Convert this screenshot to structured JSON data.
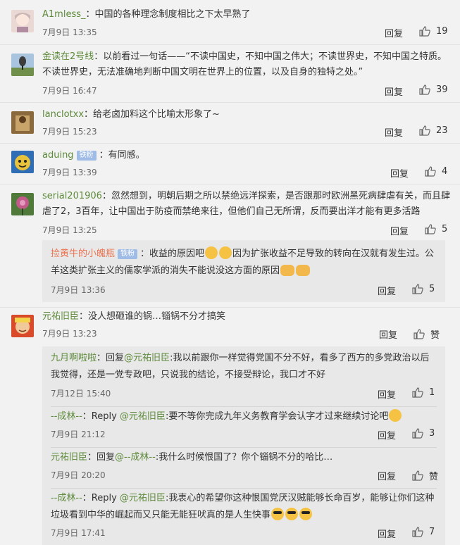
{
  "labels": {
    "reply": "回复",
    "fan_badge": "铁粉"
  },
  "comments": [
    {
      "user": "A1mless_",
      "sep": "：",
      "text": "中国的各种理念制度相比之下太早熟了",
      "time": "7月9日 13:35",
      "likes": "19"
    },
    {
      "user": "金读在2号线",
      "sep": "：",
      "text": "以前看过一句话——“不读中国史，不知中国之伟大；不读世界史，不知中国之特质。不读世界史，无法准确地判断中国文明在世界上的位置，以及自身的独特之处。”",
      "time": "7月9日 16:47",
      "likes": "39"
    },
    {
      "user": "lanclotxx",
      "sep": "：",
      "text": "给老卤加料这个比喻太形象了~",
      "time": "7月9日 15:23",
      "likes": "23"
    },
    {
      "user": "aduing",
      "sep": "：",
      "text": "有同感。",
      "time": "7月9日 13:39",
      "likes": "4"
    },
    {
      "user": "serial201906",
      "sep": "：",
      "text": "忽然想到，明朝后期之所以禁绝远洋探索，是否跟那时欧洲黑死病肆虐有关，而且肆虐了2，3百年，让中国出于防疫而禁绝来往，但他们自己无所谓，反而要出洋才能有更多活路",
      "time": "7月9日 13:25",
      "likes": "5"
    },
    {
      "user": "元祐旧臣",
      "sep": "：",
      "text": "没人想砸谁的锅…锱锅不分才搞笑",
      "time": "7月9日 13:23",
      "likes": "赞"
    }
  ],
  "sub1": {
    "user": "捡黄牛的小魄瓶",
    "sep": "：",
    "text_a": "收益的原因吧",
    "text_b": "因为扩张收益不足导致的转向在汉就有发生过。公羊这类扩张主义的儒家学派的消失不能说没这方面的原因",
    "time": "7月9日 13:36",
    "likes": "5"
  },
  "sub2": [
    {
      "user": "九月啊啦啦",
      "sep": "：",
      "prefix": "回复",
      "mention": "@元祐旧臣",
      "text": ":我以前跟你一样觉得党国不分不好，看多了西方的多党政治以后我觉得，还是一党专政吧，只说我的结论，不接受辩论，我口才不好",
      "time": "7月12日 15:40",
      "likes": "1"
    },
    {
      "user": "--成林--",
      "sep": "：",
      "prefix": "Reply ",
      "mention": "@元祐旧臣",
      "text": ":要不等你完成九年义务教育学会认字才过来继续讨论吧",
      "time": "7月9日 21:12",
      "likes": "3"
    },
    {
      "user": "元祐旧臣",
      "sep": "：",
      "prefix": "回复",
      "mention": "@--成林--",
      "text": ":我什么时候恨国了？你个锱锅不分的哈比…",
      "time": "7月9日 20:20",
      "likes": "赞"
    },
    {
      "user": "--成林--",
      "sep": "：",
      "prefix": "Reply ",
      "mention": "@元祐旧臣",
      "text": ":我衷心的希望你这种恨国党厌汉贼能够长命百岁，能够让你们这种垃圾看到中华的崛起而又只能无能狂吠真的是人生快事",
      "time": "7月9日 17:41",
      "likes": "7"
    }
  ]
}
